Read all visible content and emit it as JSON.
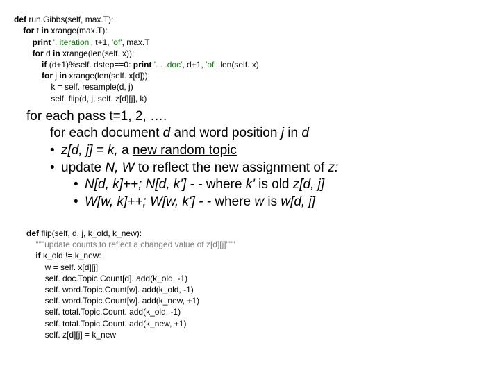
{
  "code_top": {
    "l1_kw": "def",
    "l1_rest": " run.Gibbs(self, max.T):",
    "l2_pre": "    ",
    "l2_kw": "for",
    "l2_mid": " t ",
    "l2_kw2": "in",
    "l2_rest": " xrange(max.T):",
    "l3_pre": "        ",
    "l3_kw": "print",
    "l3_str": " '. iteration'",
    "l3_rest": ", t+1, ",
    "l3_str2": "'of'",
    "l3_rest2": ", max.T",
    "l4_pre": "        ",
    "l4_kw": "for",
    "l4_mid": " d ",
    "l4_kw2": "in",
    "l4_rest": " xrange(len(self. x)):",
    "l5_pre": "            ",
    "l5_kw": "if",
    "l5_mid": " (d+1)%self. dstep==0: ",
    "l5_kw2": "print",
    "l5_str": " '. . .doc'",
    "l5_rest": ", d+1, ",
    "l5_str2": "'of'",
    "l5_rest2": ", len(self. x)",
    "l6_pre": "            ",
    "l6_kw": "for",
    "l6_mid": " j ",
    "l6_kw2": "in",
    "l6_rest": " xrange(len(self. x[d])):",
    "l7": "                k = self. resample(d, j)",
    "l8": "                self. flip(d, j, self. z[d][j], k)"
  },
  "pseudo": {
    "l1_a": "for each pass t=1, 2, ….",
    "l2_a": "for each document ",
    "l2_b": "d",
    "l2_c": " and word position ",
    "l2_d": "j",
    "l2_e": " in ",
    "l2_f": "d",
    "l3_bullet": "•",
    "l3_a": "z[d, j] = k,",
    "l3_b": "   a ",
    "l3_c": "new random topic",
    "l4_bullet": "•",
    "l4_a": "update ",
    "l4_b": "N, W",
    "l4_c": " to reflect the new assignment of ",
    "l4_d": "z:",
    "l5_bullet": "•",
    "l5_a": "N[d, k]++; N[d, k'] - - ",
    "l5_b": "where ",
    "l5_c": "k' ",
    "l5_d": "is old ",
    "l5_e": "z[d, j]",
    "l6_bullet": "•",
    "l6_a": "W[w, k]++; W[w, k'] - - ",
    "l6_b": "where ",
    "l6_c": "w",
    "l6_d": " is ",
    "l6_e": "w[d, j]"
  },
  "code_bottom": {
    "l1_kw": "def",
    "l1_rest": " flip(self, d, j, k_old, k_new):",
    "l2_pre": "    ",
    "l2_str": "\"\"\"update counts to reflect a changed value of z[d][j]\"\"\"",
    "l3_pre": "    ",
    "l3_kw": "if",
    "l3_rest": " k_old != k_new:",
    "l4": "        w = self. x[d][j]",
    "l5": "        self. doc.Topic.Count[d]. add(k_old, -1)",
    "l6": "        self. word.Topic.Count[w]. add(k_old, -1)",
    "l7": "        self. word.Topic.Count[w]. add(k_new, +1)",
    "l8": "        self. total.Topic.Count. add(k_old, -1)",
    "l9": "        self. total.Topic.Count. add(k_new, +1)",
    "l10": "        self. z[d][j] = k_new"
  }
}
